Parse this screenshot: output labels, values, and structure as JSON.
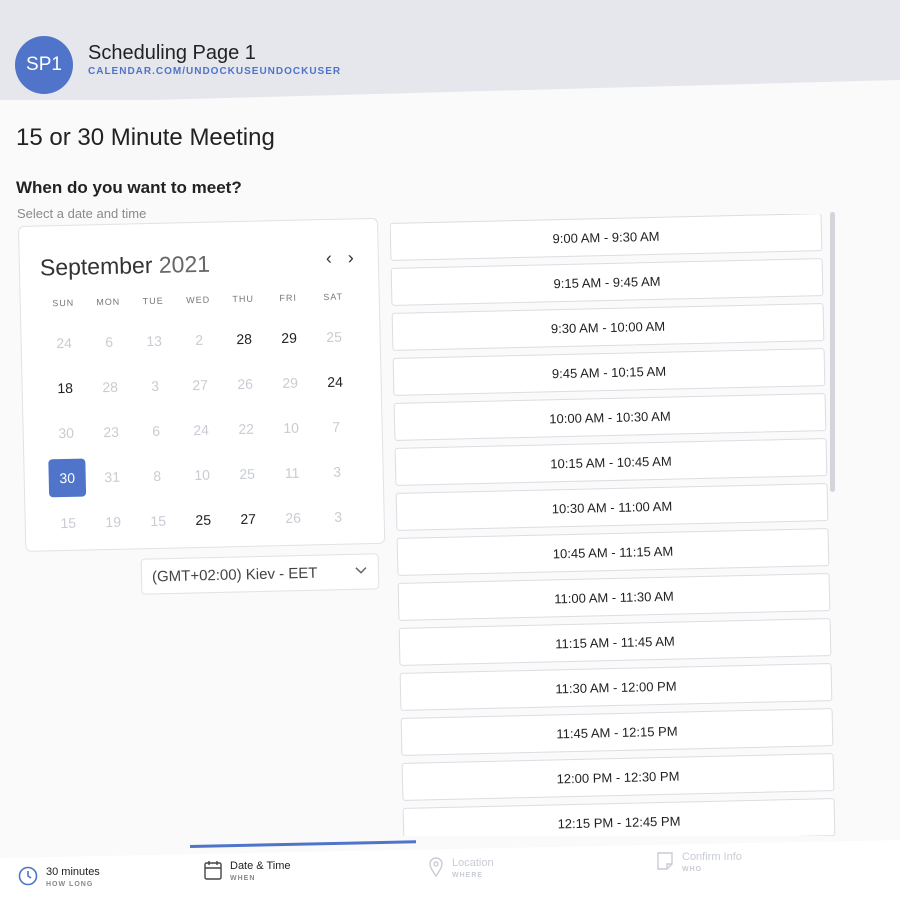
{
  "header": {
    "avatar": "SP1",
    "title": "Scheduling Page 1",
    "url": "CALENDAR.COM/UNDOCKUSEUNDOCKUSER"
  },
  "meeting_title": "15 or 30 Minute Meeting",
  "question": "When do you want to meet?",
  "subtitle": "Select a date and time",
  "calendar": {
    "month": "September",
    "year": "2021",
    "prev": "‹",
    "next": "›",
    "weekdays": [
      "SUN",
      "MON",
      "TUE",
      "WED",
      "THU",
      "FRI",
      "SAT"
    ],
    "days": [
      {
        "d": "24",
        "on": false
      },
      {
        "d": "6",
        "on": false
      },
      {
        "d": "13",
        "on": false
      },
      {
        "d": "2",
        "on": false
      },
      {
        "d": "28",
        "on": true
      },
      {
        "d": "29",
        "on": true
      },
      {
        "d": "25",
        "on": false
      },
      {
        "d": "18",
        "on": true
      },
      {
        "d": "28",
        "on": false
      },
      {
        "d": "3",
        "on": false
      },
      {
        "d": "27",
        "on": false
      },
      {
        "d": "26",
        "on": false
      },
      {
        "d": "29",
        "on": false
      },
      {
        "d": "24",
        "on": true
      },
      {
        "d": "30",
        "on": false
      },
      {
        "d": "23",
        "on": false
      },
      {
        "d": "6",
        "on": false
      },
      {
        "d": "24",
        "on": false
      },
      {
        "d": "22",
        "on": false
      },
      {
        "d": "10",
        "on": false
      },
      {
        "d": "7",
        "on": false
      },
      {
        "d": "30",
        "on": true,
        "selected": true
      },
      {
        "d": "31",
        "on": false
      },
      {
        "d": "8",
        "on": false
      },
      {
        "d": "10",
        "on": false
      },
      {
        "d": "25",
        "on": false
      },
      {
        "d": "11",
        "on": false
      },
      {
        "d": "3",
        "on": false
      },
      {
        "d": "15",
        "on": false
      },
      {
        "d": "19",
        "on": false
      },
      {
        "d": "15",
        "on": false
      },
      {
        "d": "25",
        "on": true
      },
      {
        "d": "27",
        "on": true
      },
      {
        "d": "26",
        "on": false
      },
      {
        "d": "3",
        "on": false
      }
    ],
    "selected_color": "#4f74c9"
  },
  "timezone": "(GMT+02:00) Kiev - EET",
  "slots": [
    "9:00 AM - 9:30 AM",
    "9:15 AM - 9:45 AM",
    "9:30 AM - 10:00 AM",
    "9:45 AM - 10:15 AM",
    "10:00 AM - 10:30 AM",
    "10:15 AM - 10:45 AM",
    "10:30 AM - 11:00 AM",
    "10:45 AM - 11:15 AM",
    "11:00 AM - 11:30 AM",
    "11:15 AM - 11:45 AM",
    "11:30 AM - 12:00 PM",
    "11:45 AM - 12:15 PM",
    "12:00 PM - 12:30 PM",
    "12:15 PM - 12:45 PM"
  ],
  "steps": [
    {
      "label": "30 minutes",
      "sub": "HOW LONG",
      "icon": "clock-icon",
      "state": "done"
    },
    {
      "label": "Date & Time",
      "sub": "WHEN",
      "icon": "calendar-icon",
      "state": "active"
    },
    {
      "label": "Location",
      "sub": "WHERE",
      "icon": "location-pin-icon",
      "state": "todo"
    },
    {
      "label": "Confirm Info",
      "sub": "WHO",
      "icon": "note-icon",
      "state": "todo"
    }
  ],
  "colors": {
    "accent": "#4f74c9",
    "header_bg": "#e6e7ec"
  }
}
